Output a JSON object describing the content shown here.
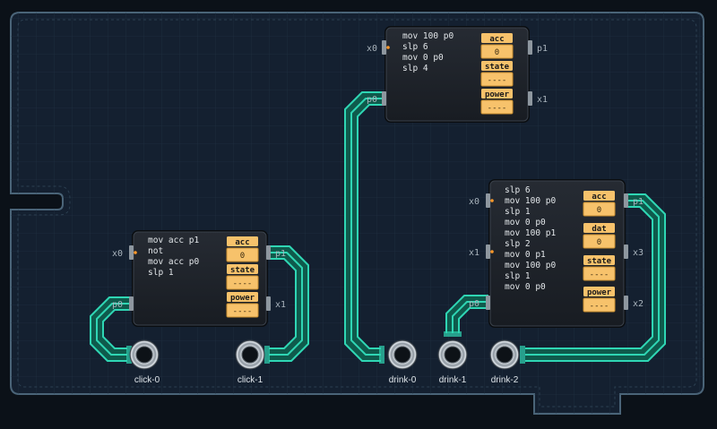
{
  "modules": [
    {
      "id": "module-a",
      "code": [
        "mov 100 p0",
        "slp 6",
        "mov 0 p0",
        "slp 4"
      ],
      "registers": [
        {
          "label": "acc",
          "value": "0"
        },
        {
          "label": "state",
          "value": "----"
        },
        {
          "label": "power",
          "value": "----"
        }
      ],
      "ports": {
        "x0": "x0",
        "p1": "p1",
        "p0": "p0",
        "x1": "x1"
      }
    },
    {
      "id": "module-b",
      "code": [
        "mov acc p1",
        "not",
        "mov acc p0",
        "slp 1"
      ],
      "registers": [
        {
          "label": "acc",
          "value": "0"
        },
        {
          "label": "state",
          "value": "----"
        },
        {
          "label": "power",
          "value": "----"
        }
      ],
      "ports": {
        "x0": "x0",
        "p1": "p1",
        "p0": "p0",
        "x1": "x1"
      }
    },
    {
      "id": "module-c",
      "code": [
        "slp 6",
        "mov 100 p0",
        "slp 1",
        "mov 0 p0",
        "mov 100 p1",
        "slp 2",
        "mov 0 p1",
        "mov 100 p0",
        "slp 1",
        "mov 0 p0"
      ],
      "registers": [
        {
          "label": "acc",
          "value": "0"
        },
        {
          "label": "dat",
          "value": "0"
        },
        {
          "label": "state",
          "value": "----"
        },
        {
          "label": "power",
          "value": "----"
        }
      ],
      "ports": {
        "x0": "x0",
        "p1": "p1",
        "x1": "x1",
        "x3": "x3",
        "p0": "p0",
        "x2": "x2"
      }
    }
  ],
  "sockets": [
    {
      "name": "click-0"
    },
    {
      "name": "click-1"
    },
    {
      "name": "drink-0"
    },
    {
      "name": "drink-1"
    },
    {
      "name": "drink-2"
    }
  ],
  "colors": {
    "background": "#0b1118",
    "board": "#1a2633",
    "wire": "#2fd6b4",
    "register": "#f7c26b",
    "module_body": "#1d2128"
  }
}
